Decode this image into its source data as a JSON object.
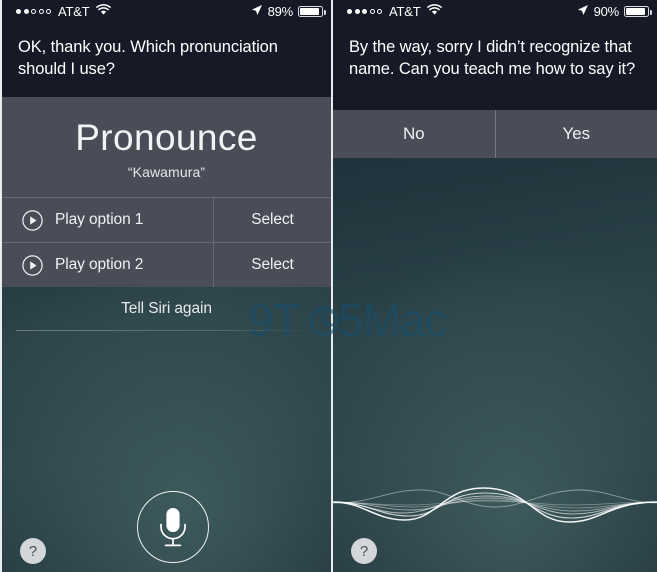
{
  "left": {
    "status": {
      "signal_dots_total": 5,
      "signal_dots_filled": 2,
      "carrier": "AT&T",
      "wifi_icon": "wifi-icon",
      "location_icon": "location-arrow-icon",
      "battery_percent": "89%",
      "battery_fill": 89
    },
    "prompt": "OK, thank you. Which pronunciation should I use?",
    "card": {
      "title": "Pronounce",
      "subtitle": "“Kawamura”",
      "options": [
        {
          "play_icon": "play-circle-icon",
          "label": "Play option 1",
          "action": "Select"
        },
        {
          "play_icon": "play-circle-icon",
          "label": "Play option 2",
          "action": "Select"
        }
      ]
    },
    "again_label": "Tell Siri again",
    "mic_icon": "microphone-icon",
    "help_label": "?"
  },
  "right": {
    "status": {
      "signal_dots_total": 5,
      "signal_dots_filled": 3,
      "carrier": "AT&T",
      "wifi_icon": "wifi-icon",
      "location_icon": "location-arrow-icon",
      "battery_percent": "90%",
      "battery_fill": 90
    },
    "prompt": "By the way, sorry I didn’t recognize that name. Can you teach me how to say it?",
    "choices": [
      {
        "label": "No"
      },
      {
        "label": "Yes"
      }
    ],
    "waveform_icon": "siri-waveform",
    "help_label": "?"
  },
  "watermark": {
    "text": "9TO5Mac",
    "color": "#1d4a66"
  },
  "colors": {
    "status_bar_bg": "#161a26",
    "prompt_bg": "#161a26",
    "card_bg": "#4a4d58",
    "background_teal": "#2b4349",
    "text_primary": "#ffffff",
    "help_bg": "#d4d7d9"
  }
}
